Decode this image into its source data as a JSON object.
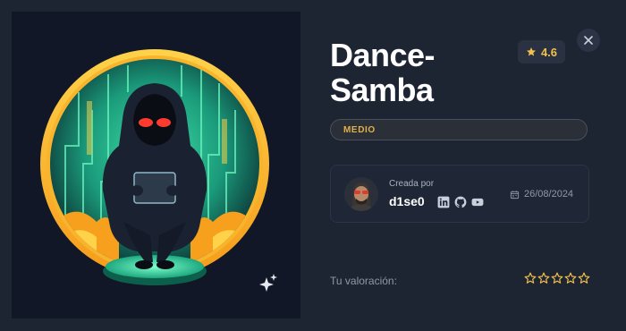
{
  "machine": {
    "title": "Dance-Samba",
    "rating": "4.6",
    "difficulty": "MEDIO"
  },
  "author": {
    "created_label": "Creada por",
    "name": "d1se0",
    "date": "26/08/2024",
    "socials": [
      "linkedin-icon",
      "github-icon",
      "youtube-icon"
    ]
  },
  "user_rating": {
    "label": "Tu valoración:",
    "stars": 5,
    "filled": 0
  },
  "icons": {
    "close": "close-icon",
    "sparkle": "sparkle-icon",
    "star": "star-icon",
    "calendar": "calendar-icon"
  },
  "colors": {
    "background": "#1d2432",
    "accent": "#f2c04c",
    "difficulty_text": "#e0b04a",
    "card": "#1f2737"
  }
}
